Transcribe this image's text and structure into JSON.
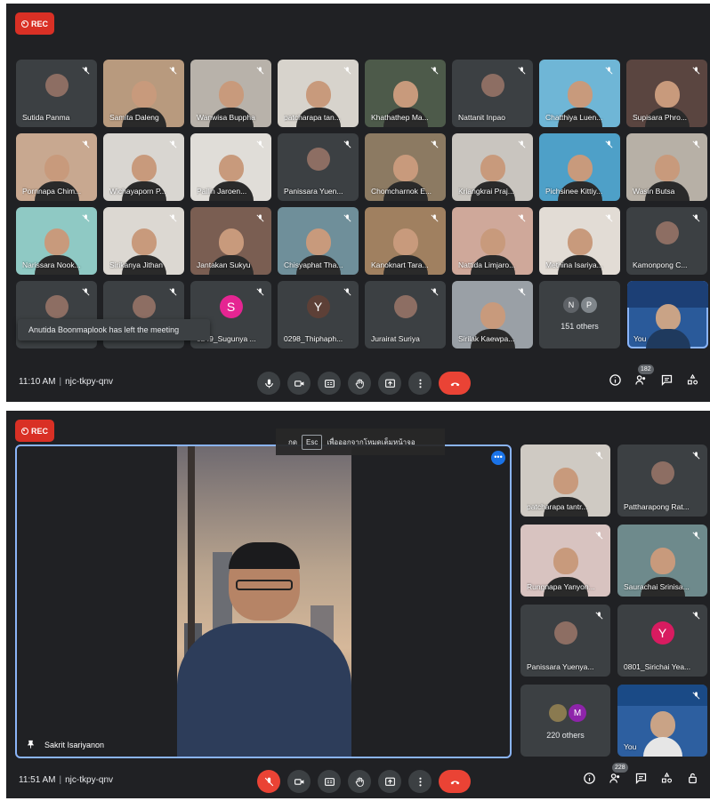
{
  "top": {
    "rec_label": "REC",
    "toast": "Anutida Boonmaplook has left the meeting",
    "time": "11:10 AM",
    "meeting_code": "njc-tkpy-qnv",
    "participants_count": "182",
    "others_label": "151 others",
    "others_initials": [
      "N",
      "P"
    ],
    "self_label": "You",
    "tiles": [
      {
        "name": "Sutida Panma",
        "bg": "#3c4043",
        "kind": "avatar-img"
      },
      {
        "name": "Samita Daleng",
        "bg": "#b89a7e",
        "kind": "photo"
      },
      {
        "name": "Wanwisa Buppha",
        "bg": "#b8b2aa",
        "kind": "photo"
      },
      {
        "name": "patcharapa tan...",
        "bg": "#d7d3cc",
        "kind": "photo"
      },
      {
        "name": "Khathathep Ma...",
        "bg": "#4d5a4a",
        "kind": "photo"
      },
      {
        "name": "Nattanit Inpao",
        "bg": "#3c4043",
        "kind": "avatar-img"
      },
      {
        "name": "Chatthiya Luen...",
        "bg": "#6fb6d6",
        "kind": "photo"
      },
      {
        "name": "Supisara Phro...",
        "bg": "#5a4540",
        "kind": "photo"
      },
      {
        "name": "Pornnapa Chim...",
        "bg": "#c8a890",
        "kind": "photo"
      },
      {
        "name": "Wichayaporn P...",
        "bg": "#d9d6d1",
        "kind": "photo"
      },
      {
        "name": "Pailin Jaroen...",
        "bg": "#e0ddd8",
        "kind": "photo"
      },
      {
        "name": "Panissara Yuen...",
        "bg": "#3c4043",
        "kind": "avatar-img"
      },
      {
        "name": "Chomcharnok E...",
        "bg": "#8c7a62",
        "kind": "photo"
      },
      {
        "name": "Kriangkrai Praj...",
        "bg": "#c9c5bf",
        "kind": "photo"
      },
      {
        "name": "Pichsinee Kittiy...",
        "bg": "#4ea0c8",
        "kind": "photo"
      },
      {
        "name": "Wasin Butsa",
        "bg": "#b7b0a6",
        "kind": "photo"
      },
      {
        "name": "Narissara Nook...",
        "bg": "#8fc9c4",
        "kind": "photo"
      },
      {
        "name": "Sirikanya Jithan",
        "bg": "#dcd8d2",
        "kind": "photo"
      },
      {
        "name": "Jantakan Sukyu",
        "bg": "#7a5e52",
        "kind": "photo"
      },
      {
        "name": "Chisyaphat Tha...",
        "bg": "#6f8f9a",
        "kind": "photo"
      },
      {
        "name": "Kanoknart Tara...",
        "bg": "#a08060",
        "kind": "photo"
      },
      {
        "name": "Nattida Limjaro...",
        "bg": "#cfa89a",
        "kind": "photo"
      },
      {
        "name": "Methina Isariya...",
        "bg": "#e2dcd5",
        "kind": "photo"
      },
      {
        "name": "Kamonpong C...",
        "bg": "#3c4043",
        "kind": "avatar-img"
      },
      {
        "name": "",
        "bg": "#3c4043",
        "kind": "avatar-img"
      },
      {
        "name": "",
        "bg": "#3c4043",
        "kind": "avatar-img"
      },
      {
        "name": "0249_Sugunya ...",
        "bg": "#3c4043",
        "kind": "letter",
        "letter": "S",
        "color": "#e52592"
      },
      {
        "name": "0298_Thiphaph...",
        "bg": "#3c4043",
        "kind": "letter",
        "letter": "Y",
        "color": "#5d4037"
      },
      {
        "name": "Jurairat Suriya",
        "bg": "#3c4043",
        "kind": "avatar-img"
      },
      {
        "name": "Sirilak Kaewpa...",
        "bg": "#9aa0a6",
        "kind": "photo"
      }
    ]
  },
  "bottom": {
    "rec_label": "REC",
    "hint_prefix": "กด",
    "hint_key": "Esc",
    "hint_suffix": "เพื่อออกจากโหมดเต็มหน้าจอ",
    "speaker_name": "Sakrit Isariyanon",
    "time": "11:51 AM",
    "meeting_code": "njc-tkpy-qnv",
    "participants_count": "228",
    "others_label": "220 others",
    "others_initial": "M",
    "self_label": "You",
    "side_tiles": [
      {
        "name": "patcharapa tantr...",
        "bg": "#cfcac3",
        "kind": "photo"
      },
      {
        "name": "Pattharapong Rat...",
        "bg": "#3c4043",
        "kind": "avatar-img"
      },
      {
        "name": "Rungnapa Yanyon...",
        "bg": "#d8c3c0",
        "kind": "photo"
      },
      {
        "name": "Saurachai Srinisa...",
        "bg": "#6e8a8c",
        "kind": "photo"
      },
      {
        "name": "Panissara Yuenya...",
        "bg": "#3c4043",
        "kind": "avatar-img"
      },
      {
        "name": "0801_Sirichai Yea...",
        "bg": "#3c4043",
        "kind": "letter",
        "letter": "Y",
        "color": "#d81b60"
      }
    ]
  }
}
